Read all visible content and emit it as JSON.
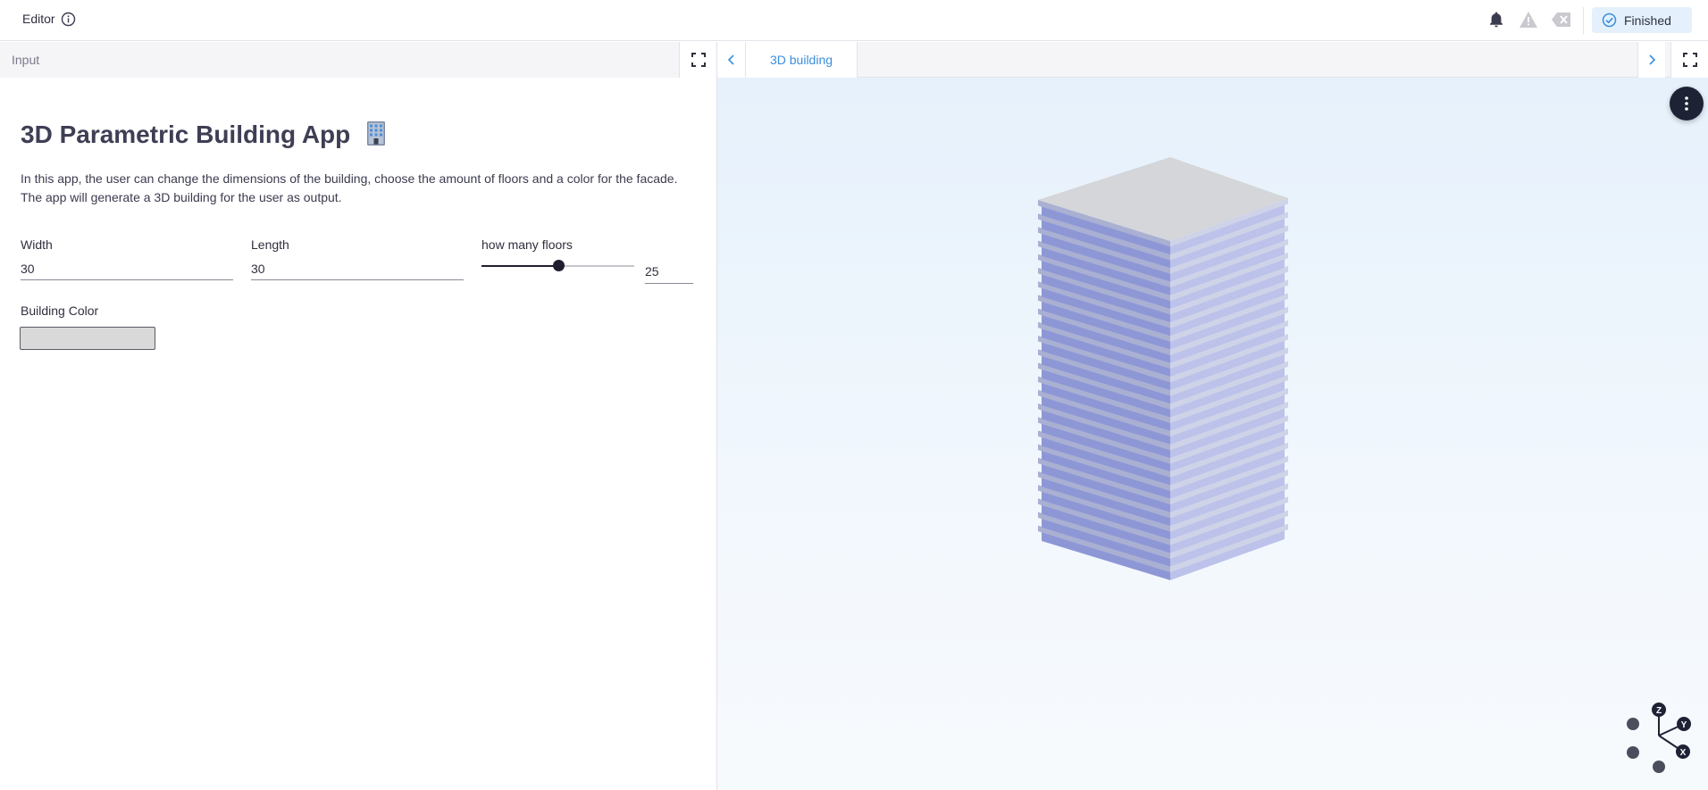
{
  "topbar": {
    "title": "Editor",
    "info_icon": "info-icon",
    "bell_icon": "bell-icon",
    "warning_icon": "warning-icon",
    "clear_icon": "clear-icon",
    "status_label": "Finished",
    "status_icon": "check-circle-icon",
    "status_color": "#e4f1fc"
  },
  "left_panel": {
    "header_label": "Input",
    "title": "3D Parametric Building App",
    "title_emoji_icon": "office-building-icon",
    "description": "In this app, the user can change the dimensions of the building, choose the amount of floors and a color for the facade. The app will generate a 3D building for the user as output.",
    "width": {
      "label": "Width",
      "value": "30"
    },
    "length": {
      "label": "Length",
      "value": "30"
    },
    "floors": {
      "label": "how many floors",
      "value": "25",
      "fraction": 0.5
    },
    "building_color": {
      "label": "Building Color",
      "value": "#d9d9d9"
    }
  },
  "right_panel": {
    "tab_label": "3D building",
    "prev_icon": "chevron-left-icon",
    "next_icon": "chevron-right-icon",
    "menu_icon": "more-vertical-icon",
    "accent": "#3b8ede",
    "axis_labels": {
      "z": "Z",
      "y": "Y",
      "x": "X"
    }
  }
}
